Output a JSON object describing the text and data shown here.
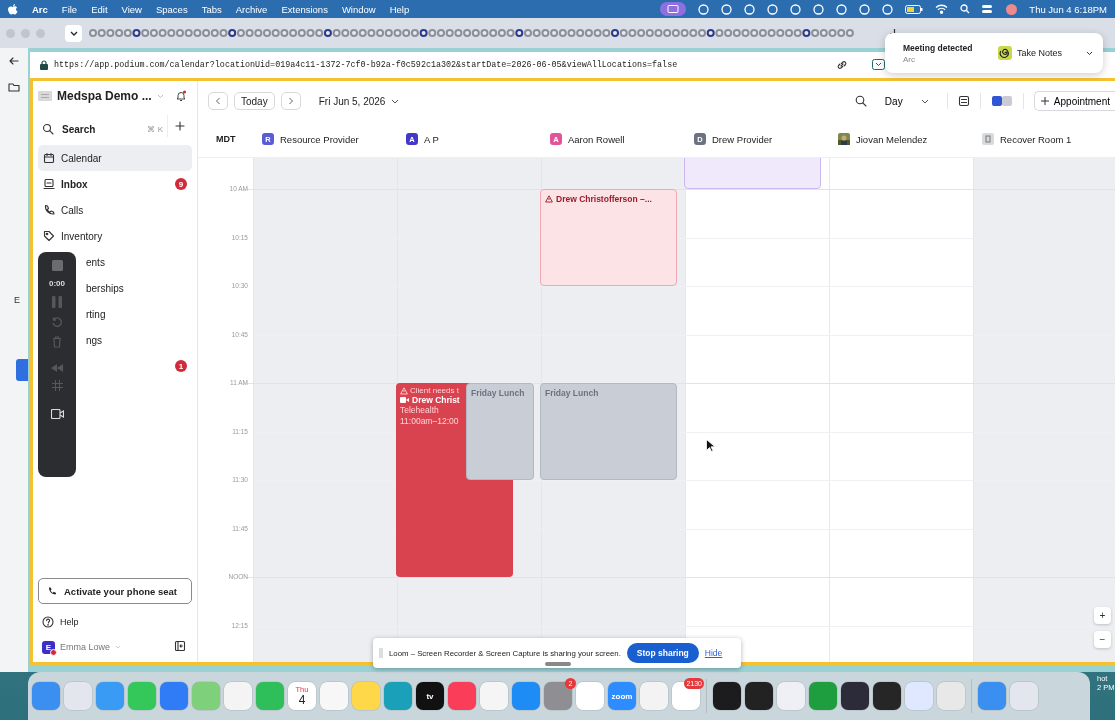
{
  "menu_bar": {
    "app": "Arc",
    "items": [
      "File",
      "Edit",
      "View",
      "Spaces",
      "Tabs",
      "Archive",
      "Extensions",
      "Window",
      "Help"
    ],
    "clock": "Thu Jun 4 6:18PM"
  },
  "browser": {
    "url": "https://app.podium.com/calendar?locationUid=019a4c11-1372-7cf0-b92a-f0c592c1a302&startDate=2026-06-05&viewAllLocations=false"
  },
  "notification": {
    "title": "Meeting detected",
    "source": "Arc",
    "action": "Take Notes"
  },
  "background_window": {
    "label": "E"
  },
  "sidebar": {
    "workspace": "Medspa Demo ...",
    "search": {
      "placeholder": "Search",
      "shortcut": "⌘ K"
    },
    "items": [
      {
        "kind": "item",
        "label": "Calendar",
        "selected": true,
        "unread": false
      },
      {
        "kind": "item",
        "label": "Inbox",
        "badge": "9",
        "selected": false,
        "unread": true
      },
      {
        "kind": "item",
        "label": "Calls",
        "selected": false,
        "unread": false
      },
      {
        "kind": "item",
        "label": "Inventory",
        "selected": false,
        "unread": false
      },
      {
        "kind": "covered",
        "label": "ents",
        "selected": false,
        "unread": false
      },
      {
        "kind": "covered",
        "label": "berships",
        "selected": false,
        "unread": false
      },
      {
        "kind": "covered",
        "label": "rting",
        "selected": false,
        "unread": false
      },
      {
        "kind": "covered",
        "label": "ngs",
        "selected": false,
        "unread": false
      }
    ],
    "covered_badge": "1",
    "phone_button": "Activate your phone seat",
    "help": "Help",
    "user": {
      "initial": "E",
      "name": "Emma Lowe"
    }
  },
  "recorder": {
    "timer": "0:00"
  },
  "calendar": {
    "toolbar": {
      "today": "Today",
      "date": "Fri Jun 5, 2026",
      "view": "Day",
      "new_button": "Appointment"
    },
    "timezone": "MDT",
    "times": [
      "10 AM",
      "10:15",
      "10:30",
      "10:45",
      "11 AM",
      "11:15",
      "11:30",
      "11:45",
      "NOON",
      "12:15"
    ],
    "resources": [
      {
        "kind": "initial",
        "name": "Resource Provider",
        "initial": "R",
        "color": "#5b5bd6",
        "available": false
      },
      {
        "kind": "initial",
        "name": "A P",
        "initial": "A",
        "color": "#4338ca",
        "available": false,
        "slots": [
          {
            "kind": "free"
          },
          {
            "kind": "free"
          },
          {
            "kind": "free"
          },
          {
            "kind": "free"
          },
          {
            "kind": "free"
          },
          {
            "kind": "busy",
            "events": [
              {
                "kind": "alert",
                "color": "#d9434f",
                "alert": "Client needs t",
                "title": "Drew Christ",
                "type": "Telehealth",
                "time": "11:00am–12:00"
              },
              {
                "kind": "block",
                "color": "#c9cdd6",
                "title": "Friday Lunch"
              }
            ]
          },
          {
            "kind": "busy",
            "events": [
              {
                "kind": "continued"
              },
              {
                "kind": "continued"
              }
            ]
          },
          {
            "kind": "busy",
            "events": [
              {
                "kind": "continued"
              }
            ]
          },
          {
            "kind": "busy",
            "events": [
              {
                "kind": "continued"
              }
            ]
          }
        ]
      },
      {
        "kind": "initial",
        "name": "Aaron Rowell",
        "initial": "A",
        "color": "#e0559a",
        "available": false,
        "slots": [
          {
            "kind": "free"
          },
          {
            "kind": "busy",
            "events": [
              {
                "kind": "warning",
                "color": "#fbe3e6",
                "title": "Drew Christofferson –..."
              }
            ]
          },
          {
            "kind": "busy",
            "events": [
              {
                "kind": "continued"
              }
            ]
          },
          {
            "kind": "free"
          },
          {
            "kind": "free"
          },
          {
            "kind": "busy",
            "events": [
              {
                "kind": "block",
                "color": "#c9cdd6",
                "title": "Friday Lunch"
              }
            ]
          },
          {
            "kind": "busy",
            "events": [
              {
                "kind": "continued"
              }
            ]
          }
        ]
      },
      {
        "kind": "initial",
        "name": "Drew Provider",
        "initial": "D",
        "color": "#6b7280",
        "available": true,
        "slots": [
          {
            "kind": "busy",
            "events": [
              {
                "kind": "placeholder",
                "color": "#efe9fb"
              }
            ]
          }
        ]
      },
      {
        "name": "Jiovan Melendez",
        "available": true
      },
      {
        "kind": "room",
        "name": "Recover Room 1",
        "available": false
      }
    ],
    "zoom": [
      "+",
      "−"
    ]
  },
  "loom_bar": {
    "message": "Loom – Screen Recorder & Screen Capture is sharing your screen.",
    "stop": "Stop sharing",
    "hide": "Hide"
  },
  "dock": [
    {
      "kind": "app"
    },
    {
      "kind": "app"
    },
    {
      "kind": "app"
    },
    {
      "kind": "app"
    },
    {
      "kind": "app"
    },
    {
      "kind": "app"
    },
    {
      "kind": "app"
    },
    {
      "kind": "app"
    },
    {
      "kind": "calendar",
      "day": "Thu",
      "date": "4"
    },
    {
      "kind": "app"
    },
    {
      "kind": "app"
    },
    {
      "kind": "app"
    },
    {
      "kind": "label",
      "text": "tv"
    },
    {
      "kind": "app"
    },
    {
      "kind": "app"
    },
    {
      "kind": "app"
    },
    {
      "kind": "app",
      "badge": "2"
    },
    {
      "kind": "app"
    },
    {
      "kind": "label",
      "text": "zoom"
    },
    {
      "kind": "app"
    },
    {
      "kind": "app",
      "badge": "2130"
    },
    {
      "kind": "divider"
    },
    {
      "kind": "app"
    },
    {
      "kind": "app"
    },
    {
      "kind": "app"
    },
    {
      "kind": "app"
    },
    {
      "kind": "app"
    },
    {
      "kind": "app"
    },
    {
      "kind": "app"
    },
    {
      "kind": "app"
    },
    {
      "kind": "divider"
    },
    {
      "kind": "app"
    },
    {
      "kind": "app"
    }
  ],
  "desktop_label": [
    "hot",
    "2 PM"
  ]
}
